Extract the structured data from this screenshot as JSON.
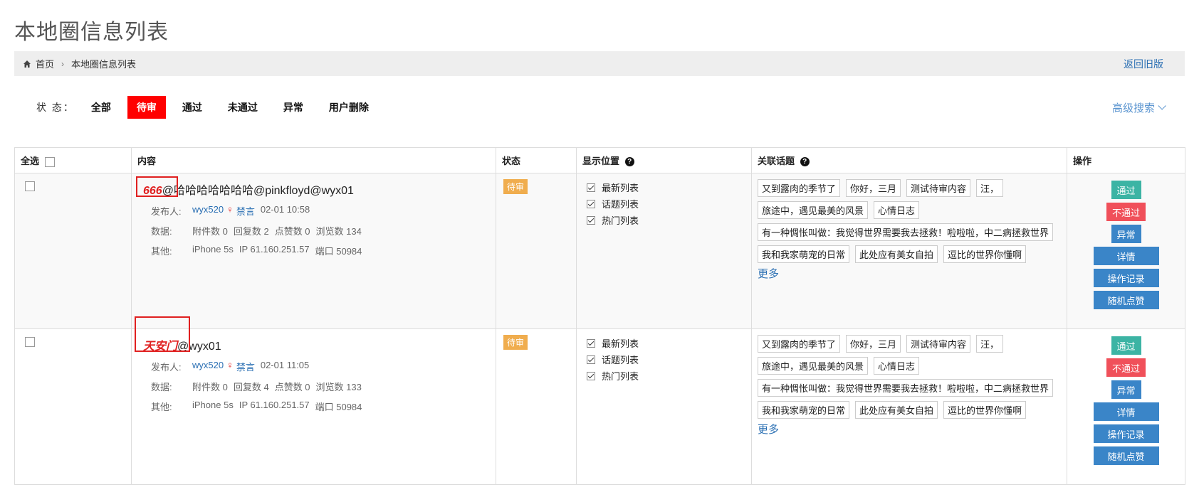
{
  "page_title": "本地圈信息列表",
  "breadcrumb": {
    "home": "首页",
    "current": "本地圈信息列表",
    "back_link": "返回旧版"
  },
  "filter": {
    "label": "状 态：",
    "options": [
      "全部",
      "待审",
      "通过",
      "未通过",
      "异常",
      "用户删除"
    ],
    "active": "待审",
    "advanced_search": "高级搜索"
  },
  "table": {
    "headers": {
      "select_all": "全选",
      "content": "内容",
      "status": "状态",
      "display_position": "显示位置",
      "topics": "关联话题",
      "actions": "操作"
    },
    "rows": [
      {
        "tag": "666",
        "text": "@哈哈哈哈哈哈哈@pinkfloyd@wyx01",
        "publisher_label": "发布人:",
        "publisher": "wyx520",
        "ban": "禁言",
        "time": "02-01 10:58",
        "data_label": "数据:",
        "attachments": "附件数 0",
        "replies": "回复数 2",
        "likes": "点赞数 0",
        "views": "浏览数 134",
        "other_label": "其他:",
        "device": "iPhone 5s",
        "ip": "IP 61.160.251.57",
        "port": "端口 50984",
        "status": "待审",
        "positions": [
          "最新列表",
          "话题列表",
          "热门列表"
        ],
        "topics": [
          "又到露肉的季节了",
          "你好，三月",
          "测试待审内容",
          "汪，",
          "旅途中，遇见最美的风景",
          "心情日志",
          "有一种惆怅叫做：我觉得世界需要我去拯救！啦啦啦，中二病拯救世界",
          "我和我家萌宠的日常",
          "此处应有美女自拍",
          "逗比的世界你懂啊"
        ],
        "more": "更多",
        "actions": [
          "通过",
          "不通过",
          "异常",
          "详情",
          "操作记录",
          "随机点赞"
        ]
      },
      {
        "tag": "天安门",
        "text": "@wyx01",
        "publisher_label": "发布人:",
        "publisher": "wyx520",
        "ban": "禁言",
        "time": "02-01 11:05",
        "data_label": "数据:",
        "attachments": "附件数 0",
        "replies": "回复数 4",
        "likes": "点赞数 0",
        "views": "浏览数 133",
        "other_label": "其他:",
        "device": "iPhone 5s",
        "ip": "IP 61.160.251.57",
        "port": "端口 50984",
        "status": "待审",
        "positions": [
          "最新列表",
          "话题列表",
          "热门列表"
        ],
        "topics": [
          "又到露肉的季节了",
          "你好，三月",
          "测试待审内容",
          "汪，",
          "旅途中，遇见最美的风景",
          "心情日志",
          "有一种惆怅叫做：我觉得世界需要我去拯救！啦啦啦，中二病拯救世界",
          "我和我家萌宠的日常",
          "此处应有美女自拍",
          "逗比的世界你懂啊"
        ],
        "more": "更多",
        "actions": [
          "通过",
          "不通过",
          "异常",
          "详情",
          "操作记录",
          "随机点赞"
        ]
      }
    ]
  },
  "colors": {
    "active_filter": "#ff0000",
    "status_badge": "#f0ad4e",
    "pass_button": "#3cb4a4",
    "reject_button": "#f0505a",
    "blue_button": "#3a85c8",
    "link": "#2a6fb3"
  },
  "icons": {
    "home": "home-icon",
    "help": "question-circle-icon",
    "gender": "person-female-icon",
    "chevron": "chevron-down-icon"
  }
}
